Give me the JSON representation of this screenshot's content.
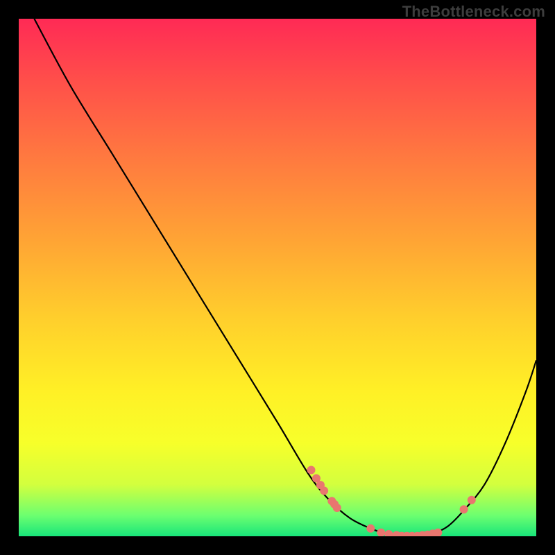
{
  "watermark": "TheBottleneck.com",
  "chart_data": {
    "type": "line",
    "title": "",
    "xlabel": "",
    "ylabel": "",
    "xlim": [
      0,
      100
    ],
    "ylim": [
      0,
      100
    ],
    "series": [
      {
        "name": "bottleneck-curve",
        "x": [
          3,
          10,
          18,
          26,
          34,
          42,
          50,
          56,
          60,
          64,
          68,
          71,
          74,
          77,
          80,
          83,
          86,
          90,
          94,
          98,
          100
        ],
        "y": [
          100,
          87,
          74,
          61,
          48,
          35,
          22,
          12,
          7,
          3.5,
          1.5,
          0.5,
          0,
          0,
          0.5,
          2,
          5,
          10,
          18,
          28,
          34
        ]
      }
    ],
    "markers": [
      {
        "name": "left-cluster",
        "points": [
          [
            56.5,
            12.8
          ],
          [
            57.5,
            11.2
          ],
          [
            58.3,
            9.9
          ],
          [
            59,
            8.8
          ],
          [
            60.5,
            6.8
          ],
          [
            61,
            6.2
          ],
          [
            61.5,
            5.5
          ]
        ]
      },
      {
        "name": "valley-cluster",
        "points": [
          [
            68,
            1.5
          ],
          [
            70,
            0.7
          ],
          [
            71.5,
            0.4
          ],
          [
            73,
            0.2
          ],
          [
            74,
            0.05
          ],
          [
            75,
            0.05
          ],
          [
            76,
            0.05
          ],
          [
            77,
            0.05
          ],
          [
            78,
            0.2
          ],
          [
            79,
            0.3
          ],
          [
            80,
            0.5
          ],
          [
            81,
            0.7
          ]
        ]
      },
      {
        "name": "right-pair",
        "points": [
          [
            86,
            5.2
          ],
          [
            87.5,
            7.0
          ]
        ]
      }
    ],
    "marker_color": "#e9766f",
    "curve_color": "#000000"
  }
}
